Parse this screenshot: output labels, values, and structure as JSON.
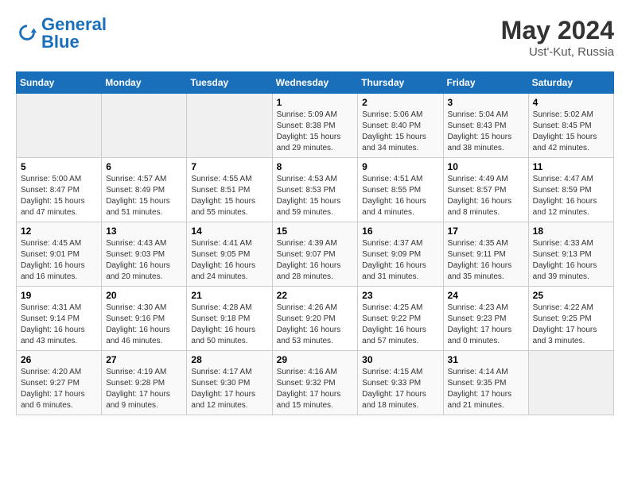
{
  "header": {
    "logo_general": "General",
    "logo_blue": "Blue",
    "month_year": "May 2024",
    "location": "Ust'-Kut, Russia"
  },
  "days_of_week": [
    "Sunday",
    "Monday",
    "Tuesday",
    "Wednesday",
    "Thursday",
    "Friday",
    "Saturday"
  ],
  "weeks": [
    [
      {
        "day": "",
        "info": ""
      },
      {
        "day": "",
        "info": ""
      },
      {
        "day": "",
        "info": ""
      },
      {
        "day": "1",
        "info": "Sunrise: 5:09 AM\nSunset: 8:38 PM\nDaylight: 15 hours\nand 29 minutes."
      },
      {
        "day": "2",
        "info": "Sunrise: 5:06 AM\nSunset: 8:40 PM\nDaylight: 15 hours\nand 34 minutes."
      },
      {
        "day": "3",
        "info": "Sunrise: 5:04 AM\nSunset: 8:43 PM\nDaylight: 15 hours\nand 38 minutes."
      },
      {
        "day": "4",
        "info": "Sunrise: 5:02 AM\nSunset: 8:45 PM\nDaylight: 15 hours\nand 42 minutes."
      }
    ],
    [
      {
        "day": "5",
        "info": "Sunrise: 5:00 AM\nSunset: 8:47 PM\nDaylight: 15 hours\nand 47 minutes."
      },
      {
        "day": "6",
        "info": "Sunrise: 4:57 AM\nSunset: 8:49 PM\nDaylight: 15 hours\nand 51 minutes."
      },
      {
        "day": "7",
        "info": "Sunrise: 4:55 AM\nSunset: 8:51 PM\nDaylight: 15 hours\nand 55 minutes."
      },
      {
        "day": "8",
        "info": "Sunrise: 4:53 AM\nSunset: 8:53 PM\nDaylight: 15 hours\nand 59 minutes."
      },
      {
        "day": "9",
        "info": "Sunrise: 4:51 AM\nSunset: 8:55 PM\nDaylight: 16 hours\nand 4 minutes."
      },
      {
        "day": "10",
        "info": "Sunrise: 4:49 AM\nSunset: 8:57 PM\nDaylight: 16 hours\nand 8 minutes."
      },
      {
        "day": "11",
        "info": "Sunrise: 4:47 AM\nSunset: 8:59 PM\nDaylight: 16 hours\nand 12 minutes."
      }
    ],
    [
      {
        "day": "12",
        "info": "Sunrise: 4:45 AM\nSunset: 9:01 PM\nDaylight: 16 hours\nand 16 minutes."
      },
      {
        "day": "13",
        "info": "Sunrise: 4:43 AM\nSunset: 9:03 PM\nDaylight: 16 hours\nand 20 minutes."
      },
      {
        "day": "14",
        "info": "Sunrise: 4:41 AM\nSunset: 9:05 PM\nDaylight: 16 hours\nand 24 minutes."
      },
      {
        "day": "15",
        "info": "Sunrise: 4:39 AM\nSunset: 9:07 PM\nDaylight: 16 hours\nand 28 minutes."
      },
      {
        "day": "16",
        "info": "Sunrise: 4:37 AM\nSunset: 9:09 PM\nDaylight: 16 hours\nand 31 minutes."
      },
      {
        "day": "17",
        "info": "Sunrise: 4:35 AM\nSunset: 9:11 PM\nDaylight: 16 hours\nand 35 minutes."
      },
      {
        "day": "18",
        "info": "Sunrise: 4:33 AM\nSunset: 9:13 PM\nDaylight: 16 hours\nand 39 minutes."
      }
    ],
    [
      {
        "day": "19",
        "info": "Sunrise: 4:31 AM\nSunset: 9:14 PM\nDaylight: 16 hours\nand 43 minutes."
      },
      {
        "day": "20",
        "info": "Sunrise: 4:30 AM\nSunset: 9:16 PM\nDaylight: 16 hours\nand 46 minutes."
      },
      {
        "day": "21",
        "info": "Sunrise: 4:28 AM\nSunset: 9:18 PM\nDaylight: 16 hours\nand 50 minutes."
      },
      {
        "day": "22",
        "info": "Sunrise: 4:26 AM\nSunset: 9:20 PM\nDaylight: 16 hours\nand 53 minutes."
      },
      {
        "day": "23",
        "info": "Sunrise: 4:25 AM\nSunset: 9:22 PM\nDaylight: 16 hours\nand 57 minutes."
      },
      {
        "day": "24",
        "info": "Sunrise: 4:23 AM\nSunset: 9:23 PM\nDaylight: 17 hours\nand 0 minutes."
      },
      {
        "day": "25",
        "info": "Sunrise: 4:22 AM\nSunset: 9:25 PM\nDaylight: 17 hours\nand 3 minutes."
      }
    ],
    [
      {
        "day": "26",
        "info": "Sunrise: 4:20 AM\nSunset: 9:27 PM\nDaylight: 17 hours\nand 6 minutes."
      },
      {
        "day": "27",
        "info": "Sunrise: 4:19 AM\nSunset: 9:28 PM\nDaylight: 17 hours\nand 9 minutes."
      },
      {
        "day": "28",
        "info": "Sunrise: 4:17 AM\nSunset: 9:30 PM\nDaylight: 17 hours\nand 12 minutes."
      },
      {
        "day": "29",
        "info": "Sunrise: 4:16 AM\nSunset: 9:32 PM\nDaylight: 17 hours\nand 15 minutes."
      },
      {
        "day": "30",
        "info": "Sunrise: 4:15 AM\nSunset: 9:33 PM\nDaylight: 17 hours\nand 18 minutes."
      },
      {
        "day": "31",
        "info": "Sunrise: 4:14 AM\nSunset: 9:35 PM\nDaylight: 17 hours\nand 21 minutes."
      },
      {
        "day": "",
        "info": ""
      }
    ]
  ]
}
